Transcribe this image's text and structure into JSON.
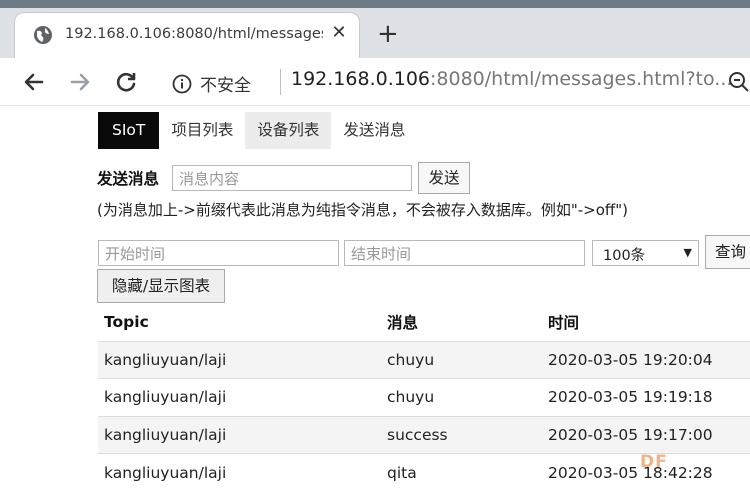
{
  "browser": {
    "tab_title": "192.168.0.106:8080/html/messages",
    "tab_close": "✕",
    "new_tab": "+",
    "security_label": "不安全",
    "url_host": "192.168.0.106",
    "url_rest": ":8080/html/messages.html?to..."
  },
  "nav": {
    "brand": "SIoT",
    "items": [
      {
        "label": "项目列表"
      },
      {
        "label": "设备列表"
      },
      {
        "label": "发送消息"
      }
    ]
  },
  "send": {
    "label": "发送消息",
    "placeholder": "消息内容",
    "button": "发送",
    "hint": "(为消息加上->前缀代表此消息为纯指令消息，不会被存入数据库。例如\"->off\")"
  },
  "filter": {
    "start_placeholder": "开始时间",
    "end_placeholder": "结束时间",
    "count_value": "100条",
    "query_button": "查询",
    "toggle_chart_button": "隐藏/显示图表"
  },
  "table": {
    "headers": [
      "Topic",
      "消息",
      "时间"
    ],
    "rows": [
      [
        "kangliuyuan/laji",
        "chuyu",
        "2020-03-05 19:20:04"
      ],
      [
        "kangliuyuan/laji",
        "chuyu",
        "2020-03-05 19:19:18"
      ],
      [
        "kangliuyuan/laji",
        "success",
        "2020-03-05 19:17:00"
      ],
      [
        "kangliuyuan/laji",
        "qita",
        "2020-03-05 18:42:28"
      ]
    ]
  },
  "watermark": "DF",
  "colors": {
    "brand_bg": "#0a0a0a",
    "active_tab_bg": "#ececec",
    "row_alt_bg": "#f4f4f4"
  }
}
